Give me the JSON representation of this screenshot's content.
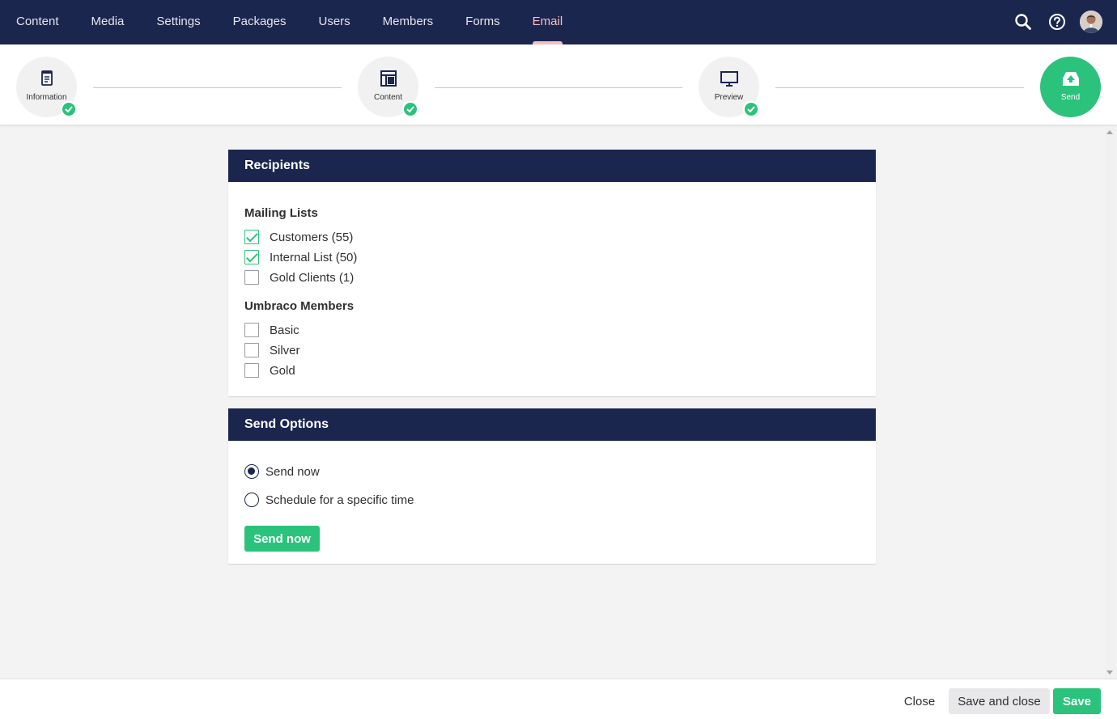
{
  "nav": {
    "items": [
      {
        "label": "Content"
      },
      {
        "label": "Media"
      },
      {
        "label": "Settings"
      },
      {
        "label": "Packages"
      },
      {
        "label": "Users"
      },
      {
        "label": "Members"
      },
      {
        "label": "Forms"
      },
      {
        "label": "Email",
        "active": true
      }
    ],
    "tools": [
      "search-icon",
      "help-icon",
      "user-avatar"
    ]
  },
  "wizard": {
    "steps": [
      {
        "label": "Information",
        "icon": "document-icon",
        "completed": true
      },
      {
        "label": "Content",
        "icon": "layout-icon",
        "completed": true
      },
      {
        "label": "Preview",
        "icon": "monitor-icon",
        "completed": true
      },
      {
        "label": "Send",
        "icon": "send-icon",
        "current": true
      }
    ]
  },
  "recipients": {
    "title": "Recipients",
    "mailing_lists_title": "Mailing Lists",
    "mailing_lists": [
      {
        "label": "Customers (55)",
        "checked": true
      },
      {
        "label": "Internal List (50)",
        "checked": true
      },
      {
        "label": "Gold Clients (1)",
        "checked": false
      }
    ],
    "members_title": "Umbraco Members",
    "members": [
      {
        "label": "Basic",
        "checked": false
      },
      {
        "label": "Silver",
        "checked": false
      },
      {
        "label": "Gold",
        "checked": false
      }
    ]
  },
  "send_options": {
    "title": "Send Options",
    "options": [
      {
        "label": "Send now",
        "selected": true
      },
      {
        "label": "Schedule for a specific time",
        "selected": false
      }
    ],
    "button_label": "Send now"
  },
  "footer": {
    "close_label": "Close",
    "save_and_close_label": "Save and close",
    "save_label": "Save"
  },
  "colors": {
    "navy": "#1b264f",
    "green": "#2bc37c",
    "active_tab": "#f5c1bc",
    "background": "#f4f3f3"
  }
}
